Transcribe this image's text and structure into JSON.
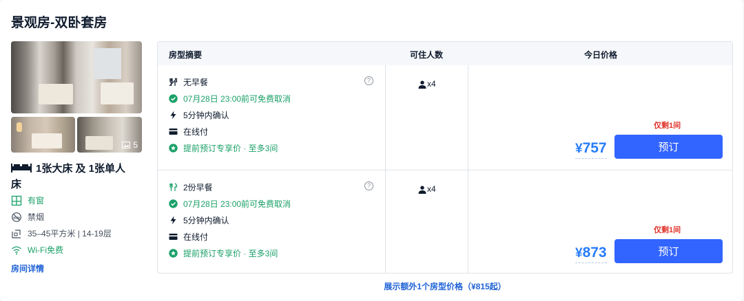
{
  "room": {
    "title": "景观房-双卧套房",
    "photo_count": "5",
    "bed_info": "1张大床 及 1张单人床",
    "features": [
      {
        "icon": "window-icon",
        "text": "有窗",
        "color": "#1aa068"
      },
      {
        "icon": "no-smoking-icon",
        "text": "禁烟",
        "color": "#454f5c"
      },
      {
        "icon": "area-icon",
        "text": "35–45平方米 | 14-19层",
        "color": "#454f5c"
      },
      {
        "icon": "wifi-icon",
        "text": "Wi-Fi免费",
        "color": "#1aa068"
      }
    ],
    "detail_link": "房间详情"
  },
  "table": {
    "headers": [
      "房型摘要",
      "可住人数",
      "今日价格"
    ],
    "rows": [
      {
        "meal": "无早餐",
        "cancel": "07月28日 23:00前可免费取消",
        "confirm": "5分钟内确认",
        "payment": "在线付",
        "promo": "提前预订专享价 · 至多3间",
        "guests": "x4",
        "remaining": "仅剩1间",
        "currency": "¥",
        "price": "757",
        "button": "预订"
      },
      {
        "meal": "2份早餐",
        "cancel": "07月28日 23:00前可免费取消",
        "confirm": "5分钟内确认",
        "payment": "在线付",
        "promo": "提前预订专享价 · 至多3间",
        "guests": "x4",
        "remaining": "仅剩1间",
        "currency": "¥",
        "price": "873",
        "button": "预订"
      }
    ]
  },
  "more_link": "展示额外1个房型价格（¥815起）",
  "colors": {
    "accent_blue": "#287dfa",
    "button_blue": "#3264ff",
    "green": "#1aa068",
    "red": "#e0312a",
    "link_blue": "#1f62d6"
  }
}
